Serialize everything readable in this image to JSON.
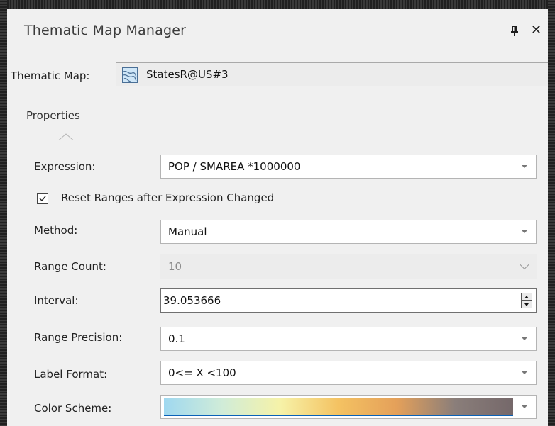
{
  "window": {
    "title": "Thematic Map Manager",
    "pin_icon": "pin-icon",
    "close_icon": "close-icon"
  },
  "thematic_map": {
    "label": "Thematic Map:",
    "value": "StatesR@US#3",
    "icon": "region-layer-icon"
  },
  "tabs": [
    "Properties"
  ],
  "properties": {
    "expression": {
      "label": "Expression:",
      "value": "POP / SMAREA *1000000"
    },
    "reset_ranges": {
      "label": "Reset Ranges after Expression Changed",
      "checked": true
    },
    "method": {
      "label": "Method:",
      "value": "Manual"
    },
    "range_count": {
      "label": "Range Count:",
      "value": "10",
      "disabled": true
    },
    "interval": {
      "label": "Interval:",
      "value": "39.053666"
    },
    "range_precision": {
      "label": "Range Precision:",
      "value": "0.1"
    },
    "label_format": {
      "label": "Label Format:",
      "value": "0<= X <100"
    },
    "color_scheme": {
      "label": "Color Scheme:",
      "colors": [
        "#9fd8f0",
        "#d0ecd8",
        "#f6f2a8",
        "#f4c262",
        "#e4a05a",
        "#8a7e7a",
        "#75686a"
      ]
    }
  },
  "colors": {
    "panel_bg": "#f0f0f0",
    "frame_bg": "#2a2a2a",
    "focus_underline": "#0a62b8"
  }
}
